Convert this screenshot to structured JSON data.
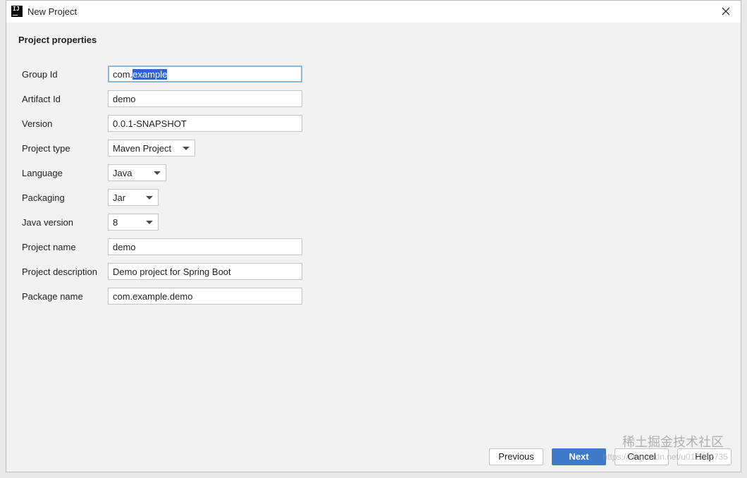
{
  "window": {
    "title": "New Project",
    "app_icon_text": "IJ"
  },
  "section": {
    "title": "Project properties"
  },
  "fields": {
    "group_id": {
      "label": "Group Id",
      "value_prefix": "com.",
      "value_selected": "example"
    },
    "artifact_id": {
      "label": "Artifact Id",
      "value": "demo"
    },
    "version": {
      "label": "Version",
      "value": "0.0.1-SNAPSHOT"
    },
    "project_type": {
      "label": "Project type",
      "value": "Maven Project"
    },
    "language": {
      "label": "Language",
      "value": "Java"
    },
    "packaging": {
      "label": "Packaging",
      "value": "Jar"
    },
    "java_version": {
      "label": "Java version",
      "value": "8"
    },
    "project_name": {
      "label": "Project name",
      "value": "demo"
    },
    "project_description": {
      "label": "Project description",
      "value": "Demo project for Spring Boot"
    },
    "package_name": {
      "label": "Package name",
      "value": "com.example.demo"
    }
  },
  "buttons": {
    "previous": "Previous",
    "next": "Next",
    "cancel": "Cancel",
    "help": "Help"
  },
  "watermark": {
    "line1": "稀土掘金技术社区",
    "line2": "https://blog.csdn.net/u012582735"
  },
  "colors": {
    "accent": "#3d7ac9",
    "selection": "#2f65ca",
    "focus_border": "#8fb4dc",
    "background": "#f2f2f2"
  }
}
